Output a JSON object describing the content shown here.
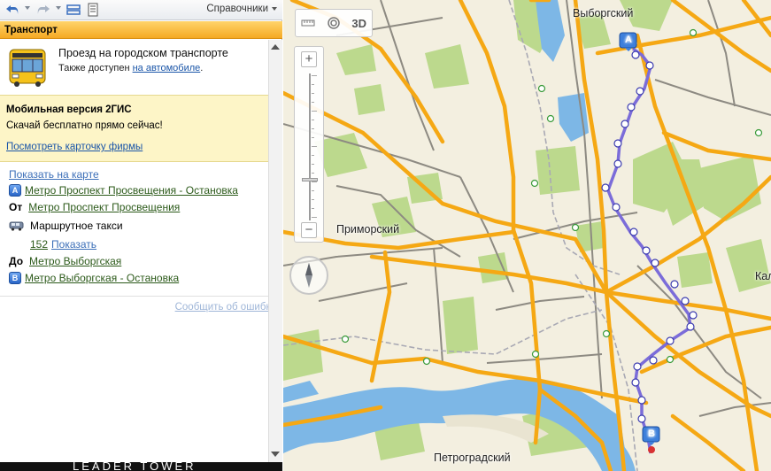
{
  "toolbar": {
    "directories_label": "Справочники"
  },
  "transport": {
    "header": "Транспорт",
    "title": "Проезд на городском транспорте",
    "sub_prefix": "Также доступен ",
    "sub_link": "на автомобиле",
    "sub_suffix": "."
  },
  "promo": {
    "title": "Мобильная версия 2ГИС",
    "text": "Скачай бесплатно прямо сейчас!",
    "link": "Посмотреть карточку фирмы"
  },
  "route": {
    "show_on_map": "Показать на карте",
    "stop_a_badge": "A",
    "stop_a": "Метро Проспект Просвещения - Остановка",
    "from_label": "От",
    "from_value": "Метро Проспект Просвещения",
    "mode": "Маршрутное такси",
    "route_number": "152",
    "route_show": "Показать",
    "to_label": "До",
    "to_value": "Метро Выборгская",
    "stop_b_badge": "B",
    "stop_b": "Метро Выборгская - Остановка",
    "report_error": "Сообщить об ошибке"
  },
  "banner": {
    "text": "LEADER TOWER"
  },
  "map": {
    "tool_3d": "3D",
    "labels": {
      "vyborgsky": "Выборгский",
      "primorsky": "Приморский",
      "petrogradsky": "Петроградский",
      "kalininsky_partial": "Кал"
    },
    "marker_a": "A",
    "marker_b": "B",
    "colors": {
      "road": "#f5a814",
      "route": "#7b6cd9",
      "water": "#7db7e6",
      "park": "#bcd98d",
      "land": "#f3efe0"
    }
  }
}
